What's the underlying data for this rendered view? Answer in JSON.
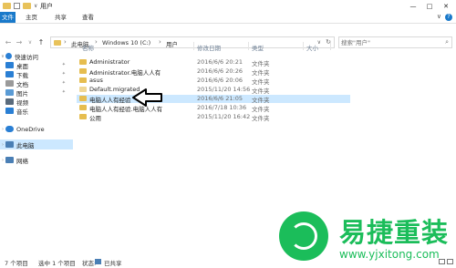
{
  "window": {
    "title": "用户",
    "controls": {
      "minimize": "—",
      "maximize": "□",
      "close": "✕"
    }
  },
  "ribbon": {
    "tabs": [
      "文件",
      "主页",
      "共享",
      "查看"
    ],
    "help": "?",
    "collapse": "∨"
  },
  "address": {
    "segments": [
      "此电脑",
      "Windows 10 (C:)",
      "用户"
    ],
    "search_placeholder": "搜索\"用户\""
  },
  "columns": {
    "name": "名称",
    "date": "修改日期",
    "type": "类型",
    "size": "大小"
  },
  "sidebar": {
    "items": [
      {
        "label": "快速访问",
        "icon": "star-icon",
        "color": "#2a7fd4"
      },
      {
        "label": "桌面",
        "icon": "desktop-icon",
        "color": "#2a7fd4",
        "pinned": true
      },
      {
        "label": "下载",
        "icon": "download-icon",
        "color": "#2a7fd4",
        "pinned": true
      },
      {
        "label": "文档",
        "icon": "document-icon",
        "color": "#8a8a8a",
        "pinned": true
      },
      {
        "label": "图片",
        "icon": "picture-icon",
        "color": "#5a9bd5",
        "pinned": true
      },
      {
        "label": "视频",
        "icon": "video-icon",
        "color": "#5a6b7c"
      },
      {
        "label": "音乐",
        "icon": "music-icon",
        "color": "#2a7fd4"
      },
      {
        "label": "OneDrive",
        "icon": "cloud-icon",
        "color": "#2a7fd4"
      },
      {
        "label": "此电脑",
        "icon": "computer-icon",
        "color": "#4a7fb5",
        "selected": true
      },
      {
        "label": "网络",
        "icon": "network-icon",
        "color": "#4a7fb5"
      }
    ]
  },
  "files": [
    {
      "name": "Administrator",
      "date": "2016/6/6 20:21",
      "type": "文件夹"
    },
    {
      "name": "Administrator.电脑人人有",
      "date": "2016/6/6 20:26",
      "type": "文件夹"
    },
    {
      "name": "asus",
      "date": "2016/6/6 20:06",
      "type": "文件夹"
    },
    {
      "name": "Default.migrated",
      "date": "2015/11/20 14:56",
      "type": "文件夹"
    },
    {
      "name": "电脑人人有经验",
      "date": "2016/6/6 21:05",
      "type": "文件夹",
      "selected": true
    },
    {
      "name": "电脑人人有经验.电脑人人有",
      "date": "2016/7/18 10:36",
      "type": "文件夹"
    },
    {
      "name": "公用",
      "date": "2015/11/20 16:42",
      "type": "文件夹"
    }
  ],
  "status": {
    "count": "7 个项目",
    "selected": "选中 1 个项目",
    "state_label": "状态:",
    "state_value": "已共享"
  },
  "watermark": {
    "title": "易捷重装",
    "url": "www.yjxitong.com"
  },
  "colors": {
    "accent": "#1979ca",
    "selection": "#cce8ff",
    "folder": "#e6bd4f",
    "brand_green": "#1bbd5a"
  }
}
